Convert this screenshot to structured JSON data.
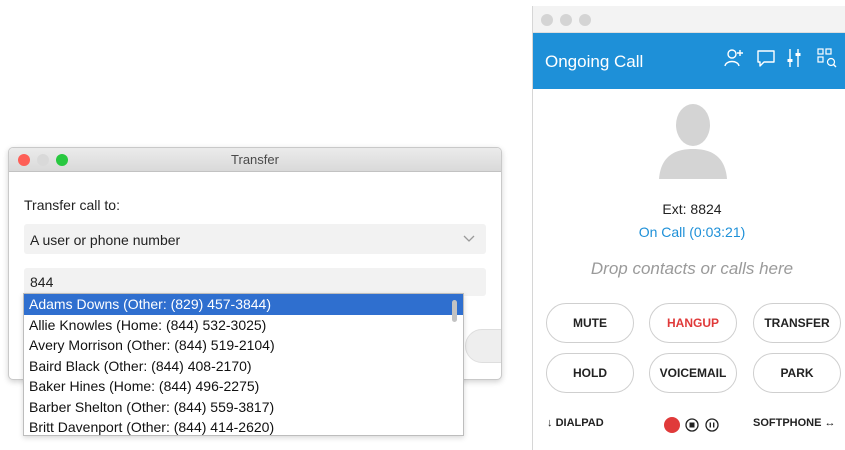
{
  "transfer_dialog": {
    "title": "Transfer",
    "prompt": "Transfer call to:",
    "target_type": "A user or phone number",
    "search_value": "844"
  },
  "suggestions": [
    "Adams Downs (Other: (829) 457-3844)",
    "Allie Knowles (Home: (844) 532-3025)",
    "Avery Morrison (Other: (844) 519-2104)",
    "Baird Black (Other: (844) 408-2170)",
    "Baker Hines (Home: (844) 496-2275)",
    "Barber Shelton (Other: (844) 559-3817)",
    "Britt Davenport (Other: (844) 414-2620)"
  ],
  "call_panel": {
    "title": "Ongoing Call",
    "ext": "Ext: 8824",
    "status": "On Call (0:03:21)",
    "drop_hint": "Drop contacts or calls here",
    "buttons": {
      "mute": "MUTE",
      "hangup": "HANGUP",
      "transfer": "TRANSFER",
      "hold": "HOLD",
      "voicemail": "VOICEMAIL",
      "park": "PARK"
    },
    "dialpad_label": "DIALPAD",
    "softphone_label": "SOFTPHONE",
    "icons": [
      "add-contact-icon",
      "chat-icon",
      "mixer-icon",
      "grid-icon",
      "record-icon",
      "stop-icon",
      "pause-icon"
    ]
  },
  "colors": {
    "accent": "#1e90d8",
    "selection": "#2f6fcf",
    "hangup": "#e03a3a",
    "record": "#e03a3a",
    "close_light": "#fe5f57",
    "minimize_light": "#d9d9d9",
    "zoom_light": "#28c840"
  }
}
